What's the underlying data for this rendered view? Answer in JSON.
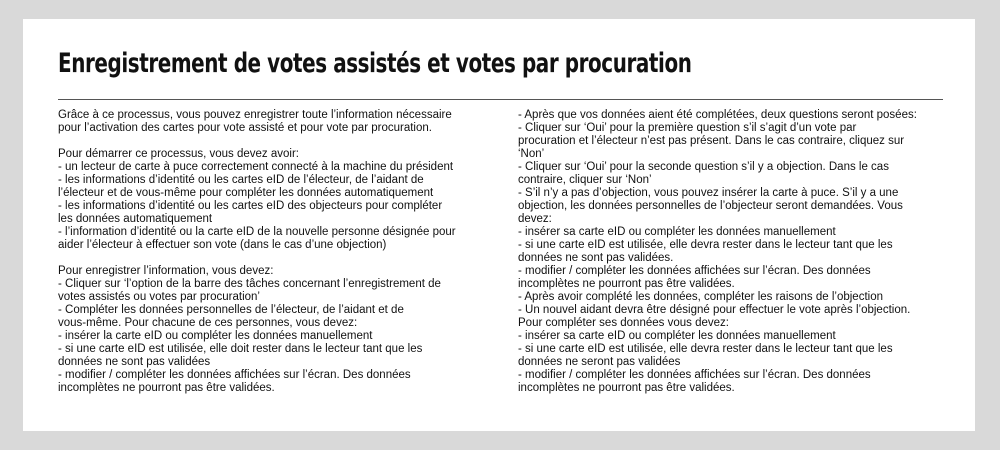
{
  "title": "Enregistrement de votes assistés et votes par procuration",
  "left_column": [
    "Grâce à ce processus, vous pouvez enregistrer toute l’information nécessaire",
    "pour l’activation des cartes pour vote assisté et pour vote par procuration.",
    "",
    "Pour démarrer ce processus, vous devez avoir:",
    "- un lecteur de carte à puce correctement connecté à la machine du président",
    "- les informations d’identité ou les cartes eID de l’électeur, de l’aidant de",
    "l’électeur et de vous-même pour compléter les données automatiquement",
    "- les informations d’identité ou les cartes eID des objecteurs pour compléter",
    "les données automatiquement",
    "- l’information d’identité ou la carte eID de la nouvelle personne désignée pour",
    "aider l’électeur à effectuer son vote (dans le cas d’une objection)",
    "",
    "Pour enregistrer l’information, vous devez:",
    "- Cliquer sur ‘l’option de la barre des tâches concernant l’enregistrement de",
    "votes assistés ou votes par procuration’",
    "- Compléter les données personnelles de l’électeur, de l’aidant et de",
    "vous-même. Pour chacune de ces personnes, vous devez:",
    "- insérer la carte eID ou compléter les données manuellement",
    "- si une carte eID est utilisée, elle doit rester dans le lecteur tant que les",
    "données ne sont pas validées",
    "- modifier / compléter les données affichées sur l’écran. Des données",
    "incomplètes ne pourront pas être validées."
  ],
  "right_column": [
    "- Après que vos données aient été complétées, deux questions seront posées:",
    "- Cliquer sur ‘Oui’ pour la première question s’il s’agit d’un vote par",
    "procuration et l’électeur n’est pas présent. Dans le cas contraire, cliquez sur",
    "‘Non’",
    "- Cliquer sur ‘Oui’ pour la seconde question s’il y a objection. Dans le cas",
    "contraire, cliquer sur ‘Non’",
    "- S’il n’y a pas d’objection, vous pouvez insérer la carte à puce. S’il y a une",
    "objection, les données personnelles de l’objecteur seront demandées. Vous",
    "devez:",
    "- insérer sa carte eID ou compléter les données manuellement",
    "- si une carte eID est utilisée, elle devra rester dans le lecteur tant que les",
    "données ne sont pas validées.",
    "- modifier / compléter les données affichées sur l’écran. Des données",
    "incomplètes ne pourront pas être validées.",
    "- Après avoir complété les données, compléter les raisons de l’objection",
    "- Un nouvel aidant devra être désigné pour effectuer le vote après l’objection.",
    "Pour compléter ses données vous devez:",
    "- insérer sa carte eID ou compléter les données manuellement",
    "- si une carte eID est utilisée, elle devra rester dans le lecteur tant que les",
    "données ne seront pas validées",
    "- modifier / compléter les données affichées sur l’écran. Des données",
    "incomplètes ne pourront pas être validées."
  ]
}
